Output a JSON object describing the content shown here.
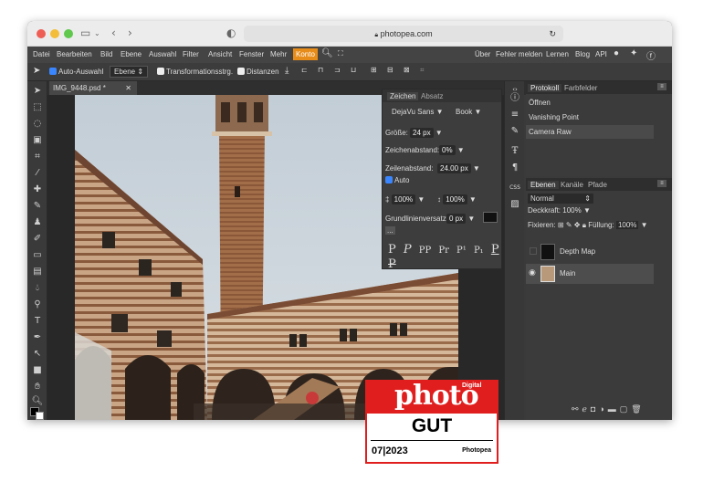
{
  "browser": {
    "url": "photopea.com",
    "traffic_lights": [
      "#ee5e55",
      "#f4bd39",
      "#5fc84d"
    ]
  },
  "menu": {
    "items": [
      "Datei",
      "Bearbeiten",
      "Bild",
      "Ebene",
      "Auswahl",
      "Filter",
      "Ansicht",
      "Fenster",
      "Mehr",
      "Konto"
    ],
    "right_items": [
      "Über",
      "Fehler melden",
      "Lernen",
      "Blog",
      "API"
    ],
    "active_item_color": "#e88c19"
  },
  "options": {
    "auto_select": "Auto-Auswahl",
    "layer_dropdown": "Ebene",
    "transform": "Transformationsstrg.",
    "distances": "Distanzen"
  },
  "document": {
    "tab_label": "IMG_9448.psd *",
    "close": "✕"
  },
  "char_panel": {
    "tabs": [
      "Zeichen",
      "Absatz"
    ],
    "font": "DejaVu Sans",
    "style": "Book",
    "size_label": "Größe:",
    "size_value": "24 px",
    "tracking_label": "Zeichenabstand:",
    "tracking_value": "0%",
    "leading_label": "Zeilenabstand:",
    "leading_value": "24.00 px",
    "auto_label": "Auto",
    "hscale_label": "100%",
    "vscale_label": "100%",
    "baseline_label": "Grundlinienversatz:",
    "baseline_value": "0 px",
    "more": "...",
    "style_glyphs": [
      "P",
      "P",
      "PP",
      "Pr",
      "P¹",
      "P₁",
      "P",
      "P"
    ]
  },
  "history_panel": {
    "tabs": [
      "Protokoll",
      "Farbfelder"
    ],
    "items": [
      "Öffnen",
      "Vanishing Point",
      "Camera Raw"
    ]
  },
  "layers_panel": {
    "tabs": [
      "Ebenen",
      "Kanäle",
      "Pfade"
    ],
    "blend_mode": "Normal",
    "opacity_label": "Deckkraft:",
    "opacity_value": "100%",
    "lock_label": "Fixieren:",
    "fill_label": "Füllung:",
    "fill_value": "100%",
    "layers": [
      "Depth Map",
      "Main"
    ]
  },
  "side_icons": {
    "css_label": "CSS"
  },
  "badge": {
    "brand_small": "Digital",
    "brand": "photo",
    "rating": "GUT",
    "date": "07|2023",
    "product": "Photopea"
  }
}
